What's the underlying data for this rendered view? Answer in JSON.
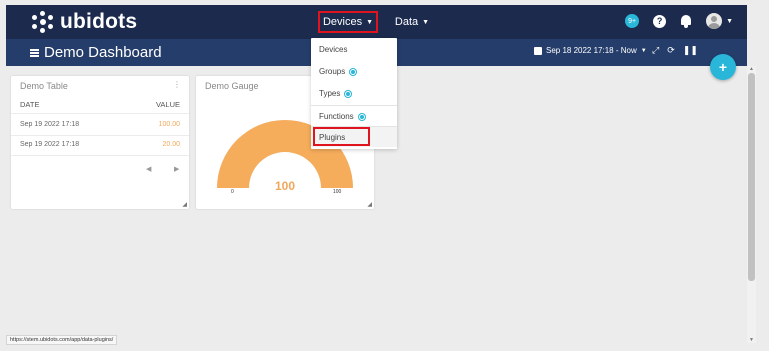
{
  "nav": {
    "brand": "ubidots",
    "devices_label": "Devices",
    "data_label": "Data",
    "notifications_badge": "9+",
    "help_label": "?"
  },
  "subbar": {
    "title": "Demo Dashboard",
    "date_range": "Sep 18 2022 17:18 - Now",
    "caret": "▼"
  },
  "fab_label": "+",
  "devices_menu": {
    "items": [
      {
        "label": "Devices"
      },
      {
        "label": "Groups"
      },
      {
        "label": "Types"
      },
      {
        "label": "Functions"
      },
      {
        "label": "Plugins"
      }
    ]
  },
  "table_widget": {
    "title": "Demo Table",
    "columns": [
      "DATE",
      "VALUE"
    ],
    "rows": [
      {
        "date": "Sep 19 2022 17:18",
        "value": "100.00"
      },
      {
        "date": "Sep 19 2022 17:18",
        "value": "20.00"
      }
    ],
    "prev": "◀",
    "next": "▶"
  },
  "gauge_widget": {
    "title": "Demo Gauge",
    "value": "100",
    "min": "0",
    "max": "100",
    "fill_fraction": 1.0,
    "color": "#f5ad5c"
  },
  "status_url": "https://stem.ubidots.com/app/data-plugins/",
  "colors": {
    "nav_bg": "#1b2a4d",
    "subbar_bg": "#243d6a",
    "accent": "#29b6d8",
    "highlight": "#e0141e"
  }
}
